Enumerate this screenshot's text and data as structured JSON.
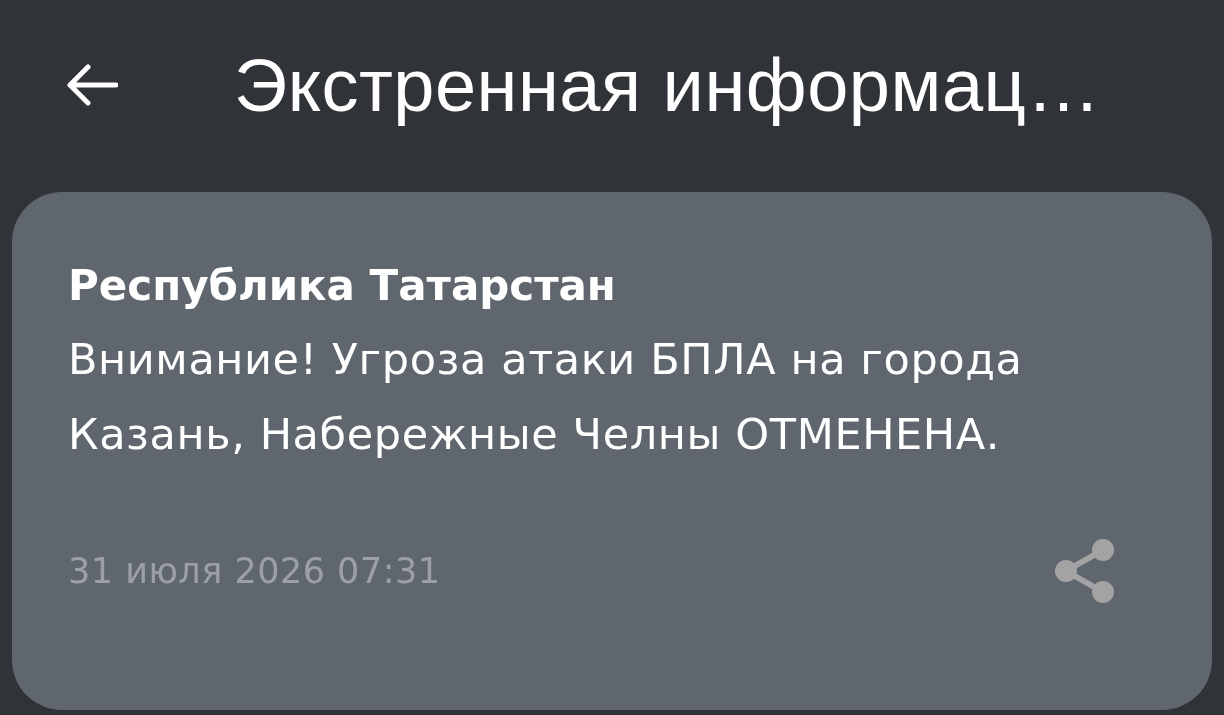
{
  "header": {
    "title": "Экстренная информац…"
  },
  "alerts": [
    {
      "region": "Республика Татарстан",
      "message": "Внимание! Угроза атаки БПЛА на города Казань, Набережные Челны ОТМЕНЕНА.",
      "timestamp": "31 июля 2026 07:31"
    }
  ]
}
